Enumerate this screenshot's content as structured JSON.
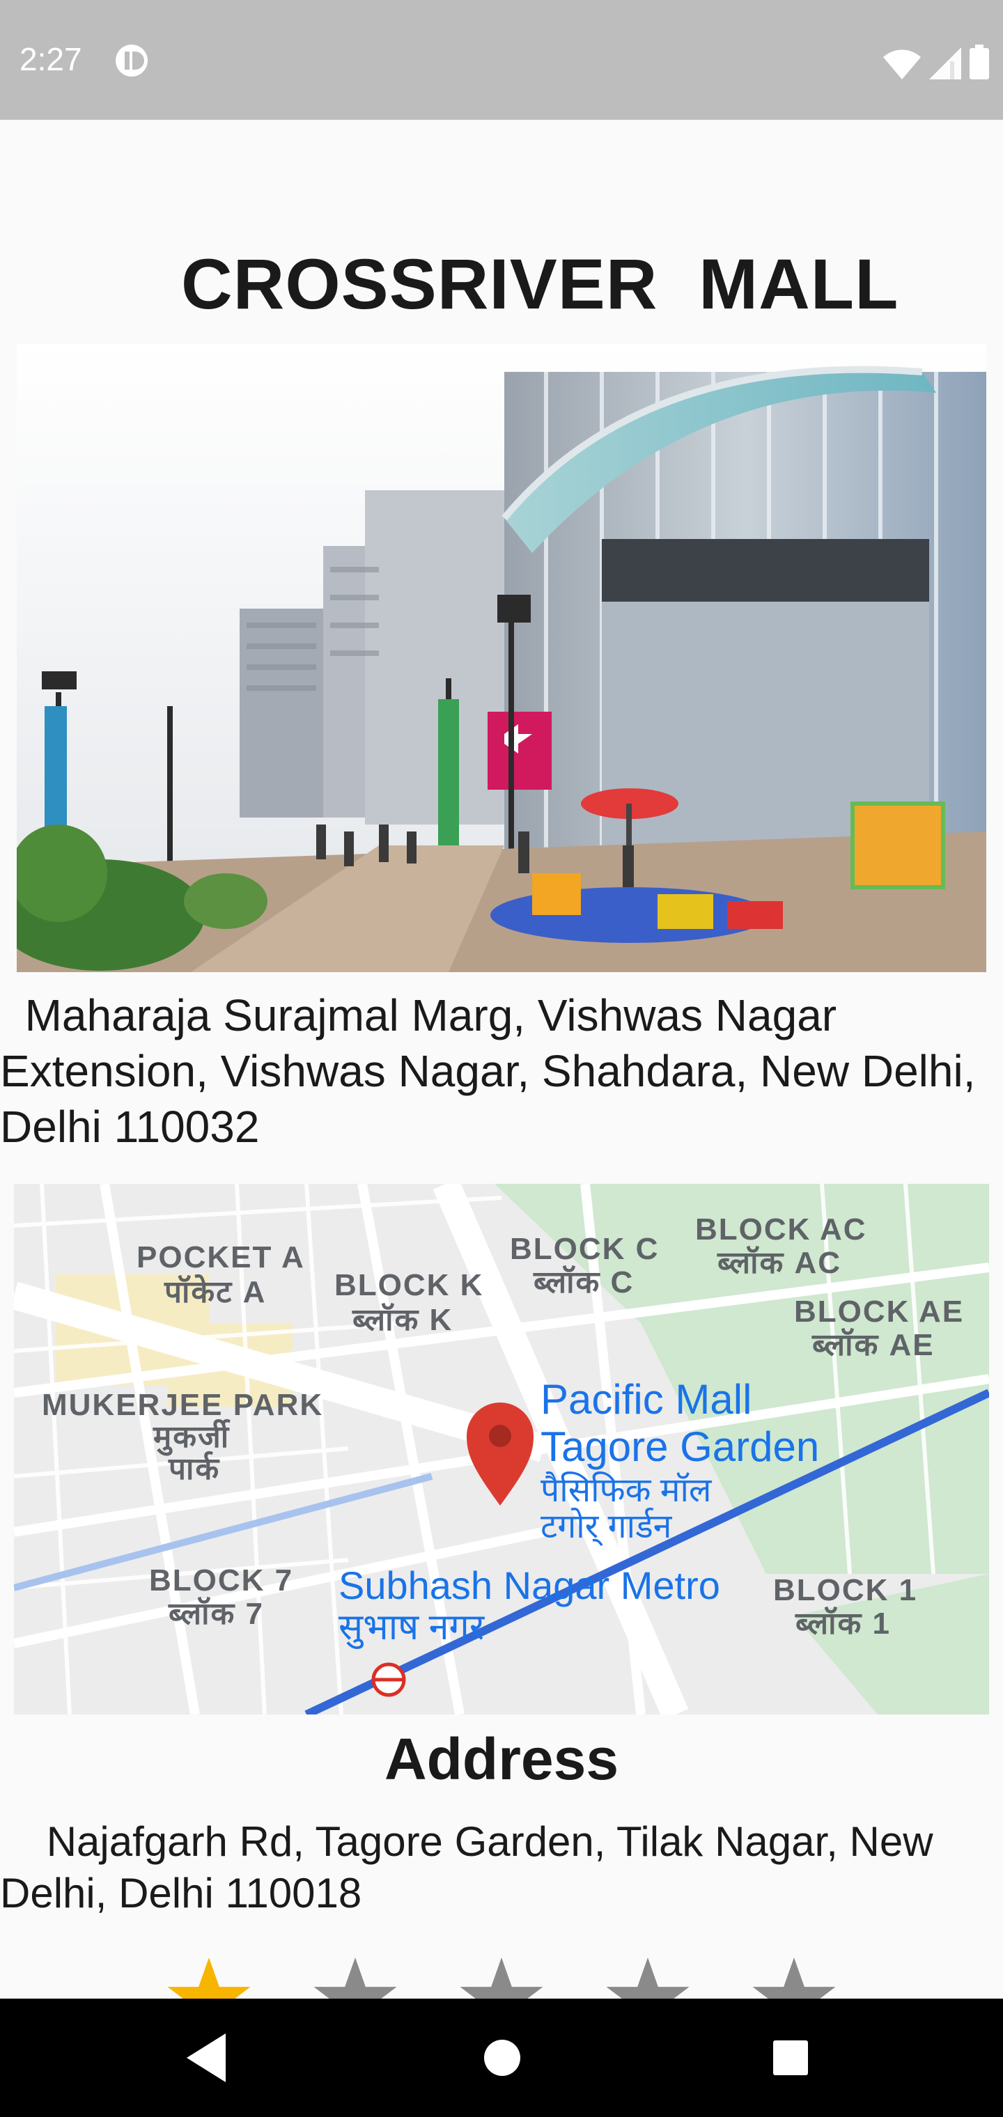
{
  "status_bar": {
    "time": "2:27",
    "icons": [
      "app-notification-icon",
      "wifi-icon",
      "signal-icon",
      "battery-icon"
    ]
  },
  "page": {
    "title": "CROSSRIVER  MALL",
    "image_subject": "mall-photo",
    "address_line": "  Maharaja Surajmal Marg, Vishwas Nagar Extension, Vishwas Nagar, Shahdara, New Delhi, Delhi 110032",
    "address_heading": "Address",
    "address_detail": "    Najafgarh Rd, Tagore Garden, Tilak Nagar, New Delhi, Delhi 110018"
  },
  "map": {
    "pin_label": "Pacific Mall",
    "pin_label2": "Tagore Garden",
    "pin_label_hi": "पैसिफिक मॉल",
    "pin_label_hi2": "टगोर् गार्डन",
    "metro_label": "Subhash Nagar Metro",
    "metro_label_hi": "सुभाष नगर",
    "areas": [
      {
        "en": "POCKET A",
        "hi": "पॉकेट A"
      },
      {
        "en": "BLOCK K",
        "hi": "ब्लॉक K"
      },
      {
        "en": "BLOCK C",
        "hi": "ब्लॉक C"
      },
      {
        "en": "BLOCK AC",
        "hi": "ब्लॉक AC"
      },
      {
        "en": "BLOCK AE",
        "hi": "ब्लॉक AE"
      },
      {
        "en": "MUKERJEE PARK",
        "hi": "मुकर्जी"
      },
      {
        "en": "",
        "hi": "पार्क"
      },
      {
        "en": "BLOCK 7",
        "hi": "ब्लॉक 7"
      },
      {
        "en": "BLOCK 1",
        "hi": "ब्लॉक 1"
      }
    ],
    "colors": {
      "road": "#ffffff",
      "base": "#ececec",
      "park": "#cfe8cf",
      "label_blue": "#1a73e8",
      "pin": "#db3b2f",
      "metro_line": "#3367d6"
    }
  },
  "rating": {
    "value": 1,
    "max": 5,
    "colors": {
      "filled": "#f7b500",
      "empty": "#8a8a8a"
    }
  },
  "nav_bar": {
    "buttons": [
      "back-icon",
      "home-icon",
      "recents-icon"
    ]
  }
}
